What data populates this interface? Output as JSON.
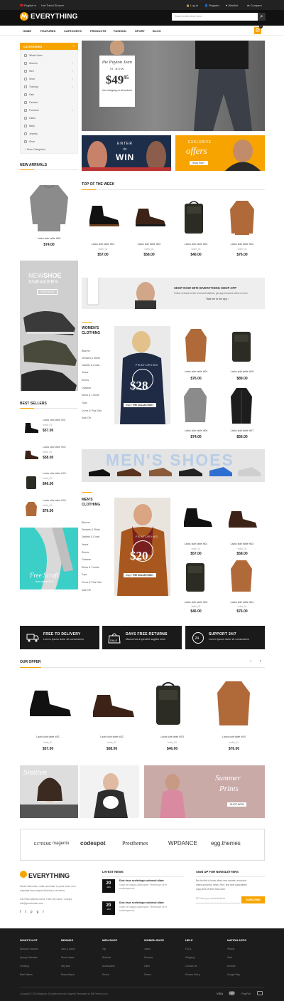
{
  "topbar": {
    "language": "English",
    "hot_trend": "Hot Trend Show",
    "login": "Log In",
    "register": "Register",
    "wishlist": "Wishlist",
    "compare": "Compare"
  },
  "header": {
    "brand": "EVERYTHING",
    "search_placeholder": "Search entire store here..."
  },
  "nav": [
    "HOME",
    "FEATURES",
    "CATEGORYS",
    "PRODUCTS",
    "FASHION",
    "SPORT",
    "BLOG"
  ],
  "cart": {
    "count": "0"
  },
  "categories": {
    "title": "CATEGORIES",
    "items": [
      "What's New",
      "Women",
      "Men",
      "Shoe",
      "Training",
      "Sale",
      "Fashion",
      "Furniture",
      "Glass",
      "Baby",
      "Jewelry",
      "Shoe",
      "More Categories"
    ]
  },
  "hero": {
    "line1": "the Payton Jean",
    "line2": "IS NOW",
    "price": "$49",
    "cents": "95",
    "note": "free shipping on all orders!"
  },
  "promo": {
    "enter_to": "ENTER",
    "to": "to",
    "win": "WIN",
    "exclusive": "EXCLUSIVE",
    "offers": "offers",
    "shop_now": "Shop now"
  },
  "new_arrivals": {
    "title": "NEW ARRIVALS",
    "name": "Lacks side table hi06",
    "price": "$74.00"
  },
  "top_week": {
    "title": "TOP OF THE WEEK",
    "items": [
      {
        "name": "Lacks side table hi01",
        "sub": "hothi_01",
        "price": "$57.00"
      },
      {
        "name": "Lacks side table hi02",
        "sub": "hothi_02",
        "price": "$58.00"
      },
      {
        "name": "Lacks side table hi03",
        "sub": "hothi_03",
        "price": "$46.00"
      },
      {
        "name": "Lacks side table hi04",
        "sub": "hothi_04",
        "price": "$76.00"
      }
    ]
  },
  "new_shoe": {
    "new": "NEW",
    "shoe": "SHOE",
    "sneakers": "SNEAKERS",
    "btn": "SHOP NOW"
  },
  "app": {
    "title": "SHOP NOW WITH EVERYTHING SHOP APP",
    "desc": "Follow & Swipe to like recommendations, get app exclusive offers & more.",
    "cta": "Take me to the app"
  },
  "womens": {
    "title": "WOMEN'S",
    "title2": "CLOTHING",
    "links": [
      "Blazers",
      "Dresses & Skirts",
      "Jackets & Coats",
      "Jeans",
      "Shorts",
      "Outwear",
      "Shirts & T-shirts",
      "Tops",
      "Curve & Plus Size",
      "Sale Off"
    ],
    "banner": {
      "featuring": "FEATURING",
      "price": "$28",
      "cta": "THE COLLECTION"
    },
    "items": [
      {
        "name": "Lacks side table hi04",
        "price": "$76.00"
      },
      {
        "name": "Lacks side table hi05",
        "price": "$89.00"
      },
      {
        "name": "Lacks side table hi06",
        "price": "$74.00"
      },
      {
        "name": "Lacks side table hi07",
        "price": "$56.00"
      }
    ]
  },
  "best_sellers": {
    "title": "BEST SELLERS",
    "items": [
      {
        "name": "Lacks side table hi01",
        "sub": "hothi_01",
        "price": "$57.00"
      },
      {
        "name": "Lacks side table hi02",
        "sub": "hothi_02",
        "price": "$58.00"
      },
      {
        "name": "Lacks side table hi03",
        "sub": "hothi_03",
        "price": "$46.00"
      },
      {
        "name": "Lacks side table hi04",
        "sub": "hothi_04",
        "price": "$76.00"
      }
    ]
  },
  "mens_shoes": {
    "title": "MEN'S SHOES"
  },
  "mens": {
    "title": "MEN'S",
    "title2": "CLOTHING",
    "links": [
      "Blazers",
      "Dresses & Skirts",
      "Jackets & Coats",
      "Jeans",
      "Shorts",
      "Outwear",
      "Shirts & T-shirts",
      "Tops",
      "Curve & Plus Size",
      "Sale Off"
    ],
    "banner": {
      "featuring": "FEATURING",
      "price": "$20",
      "cta": "THE COLLECTION"
    },
    "items": [
      {
        "name": "Lacks side table hi01",
        "sub": "hothi_01",
        "price": "$57.00"
      },
      {
        "name": "Lacks side table hi02",
        "sub": "hothi_02",
        "price": "$58.00"
      },
      {
        "name": "Lacks side table hi03",
        "sub": "hothi_03",
        "price": "$46.00"
      },
      {
        "name": "Lacks side table hi04",
        "sub": "hothi_04",
        "price": "$76.00"
      }
    ]
  },
  "free_scarf": {
    "title": "Free Scraft",
    "sub": "from spend $120"
  },
  "features": [
    {
      "title": "FREE TO DELIVERY",
      "sub": "Lorem ipsum dolor sit consectetur"
    },
    {
      "title": "DAYS FREE RETURNS",
      "sub": "Maecenas imperdiet sagittis enim"
    },
    {
      "title": "SUPPORT 24/7",
      "sub": "Lorem ipsum dolor sit consectetur"
    }
  ],
  "our_offer": {
    "title": "OUR OFFER",
    "items": [
      {
        "name": "Lacks side table hi01",
        "sub": "hothi_01",
        "price": "$57.00"
      },
      {
        "name": "Lacks side table hi02",
        "sub": "hothi_02",
        "price": "$58.00"
      },
      {
        "name": "Lacks side table hi03",
        "sub": "hothi_03",
        "price": "$46.00"
      },
      {
        "name": "Lacks side table hi04",
        "sub": "hothi_04",
        "price": "$76.00"
      }
    ]
  },
  "banners2": {
    "smitten": "Smitten",
    "summer": "Summer",
    "prints": "Prints",
    "shop_now": "SHOP NOW"
  },
  "brands": [
    "EXTREME",
    "magento",
    "codespot",
    "Presthemes",
    "WPDANCE",
    "egg.themes"
  ],
  "about": {
    "brand": "EVERYTHING",
    "text1": "Mauris bibendum, nulla accumsan et porta lorem eros",
    "text2": "vulputate lacus aliquet felis lacus vel metus.",
    "address": "234 Fake address name, Fake city name, Country",
    "email": "info@yourdomain.com"
  },
  "news": {
    "title": "LATEST NEWS",
    "items": [
      {
        "day": "20",
        "month": "JAN",
        "title": "Duis risus scelerisque euismod ullam",
        "text1": "Ullam vel magna ullamcorper. Fermentum sit et",
        "text2": "scelerisque est."
      },
      {
        "day": "20",
        "month": "JAN",
        "title": "Duis risus scelerisque euismod ullam",
        "text1": "Ullam vel magna ullamcorper. Fermentum sit et",
        "text2": "scelerisque est."
      }
    ]
  },
  "newsletter": {
    "title": "SIGN UP FOR NEWSLETTERS",
    "text1": "Be the first to know about new arrivals, exclusive",
    "text2": "offers and trend news. Plus, first time subscribers",
    "text3": "enjoy $15 off their first order.",
    "placeholder": "Enter your email address",
    "button": "SUBSCRIBE"
  },
  "footer": {
    "cols": [
      {
        "title": "WHAT'S HOT",
        "links": [
          "Discount Voucher",
          "Spring Collection",
          "Trending",
          "Best Sellers"
        ]
      },
      {
        "title": "BRANDS",
        "links": [
          "Jack & Jones",
          "Stone Island",
          "Ray Ban",
          "Brave Mépal"
        ]
      },
      {
        "title": "MEN SHOP",
        "links": [
          "Top",
          "Bottoms",
          "Accessories",
          "Shoes"
        ]
      },
      {
        "title": "WOMEN SHOP",
        "links": [
          "Jeans",
          "Dresses",
          "Other",
          "Shoes"
        ]
      },
      {
        "title": "HELP",
        "links": [
          "F.A.Q.",
          "Shipping",
          "Contact Us",
          "Privacy Policy"
        ]
      },
      {
        "title": "NATION APPS",
        "links": [
          "iPhone",
          "iPad",
          "Android",
          "Google Play"
        ]
      }
    ],
    "copyright": "Copyright © 2016 Magento. All rights reserved. Magento Templates by BWThemes.com",
    "payments": [
      "VISA",
      "PayPal"
    ]
  },
  "colors": {
    "accent": "#f7a400",
    "dark": "#1a1a1a"
  }
}
